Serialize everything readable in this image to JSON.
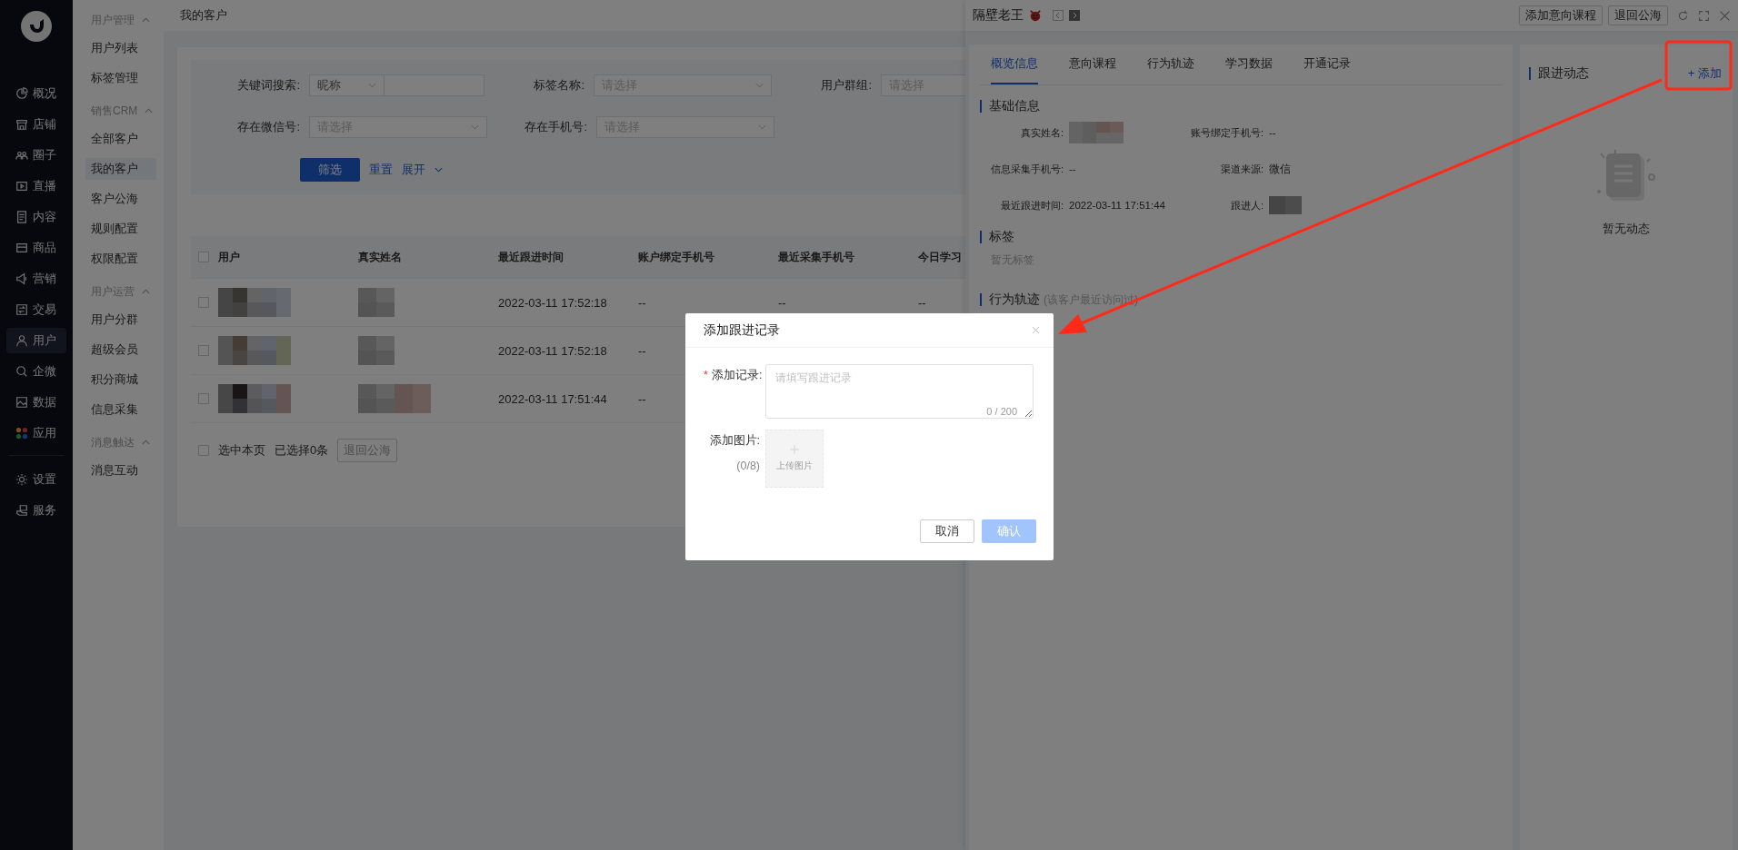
{
  "nav": {
    "primary": [
      {
        "label": "概况",
        "selected": false
      },
      {
        "label": "店铺",
        "selected": false
      },
      {
        "label": "圈子",
        "selected": false
      },
      {
        "label": "直播",
        "selected": false
      },
      {
        "label": "内容",
        "selected": false
      },
      {
        "label": "商品",
        "selected": false
      },
      {
        "label": "营销",
        "selected": false
      },
      {
        "label": "交易",
        "selected": false
      },
      {
        "label": "用户",
        "selected": true
      },
      {
        "label": "企微",
        "selected": false
      },
      {
        "label": "数据",
        "selected": false
      },
      {
        "label": "应用",
        "selected": false
      }
    ],
    "secondary": [
      {
        "label": "设置",
        "selected": false
      },
      {
        "label": "服务",
        "selected": false
      }
    ]
  },
  "submenu": [
    {
      "title": "用户管理",
      "expanded": true,
      "items": [
        {
          "label": "用户列表",
          "selected": false
        },
        {
          "label": "标签管理",
          "selected": false
        }
      ]
    },
    {
      "title": "销售CRM",
      "expanded": true,
      "items": [
        {
          "label": "全部客户",
          "selected": false
        },
        {
          "label": "我的客户",
          "selected": true
        },
        {
          "label": "客户公海",
          "selected": false
        },
        {
          "label": "规则配置",
          "selected": false
        },
        {
          "label": "权限配置",
          "selected": false
        }
      ]
    },
    {
      "title": "用户运营",
      "expanded": true,
      "items": [
        {
          "label": "用户分群",
          "selected": false
        },
        {
          "label": "超级会员",
          "selected": false
        },
        {
          "label": "积分商城",
          "selected": false
        },
        {
          "label": "信息采集",
          "selected": false
        }
      ]
    },
    {
      "title": "消息触达",
      "expanded": true,
      "items": [
        {
          "label": "消息互动",
          "selected": false
        }
      ]
    }
  ],
  "page_title": "我的客户",
  "filters": {
    "fields": [
      {
        "kind": "keyword",
        "label": "关键词搜索:",
        "select": "昵称"
      },
      {
        "kind": "select",
        "label": "标签名称:",
        "placeholder": "请选择"
      },
      {
        "kind": "select",
        "label": "用户群组:",
        "placeholder": "请选择"
      },
      {
        "kind": "select",
        "label": "存在微信号:",
        "placeholder": "请选择"
      },
      {
        "kind": "select",
        "label": "存在手机号:",
        "placeholder": "请选择"
      }
    ],
    "filter_button": "筛选",
    "reset_link": "重置",
    "expand_link": "展开"
  },
  "table": {
    "all_checked": false,
    "columns": [
      "用户",
      "真实姓名",
      "最近跟进时间",
      "账户绑定手机号",
      "最近采集手机号",
      "今日学习"
    ],
    "rows": [
      {
        "checked": false,
        "cells": [
          null,
          null,
          "2022-03-11 17:52:18",
          "--",
          "--",
          "--"
        ]
      },
      {
        "checked": false,
        "cells": [
          null,
          null,
          "2022-03-11 17:52:18",
          "--"
        ]
      },
      {
        "checked": false,
        "cells": [
          null,
          null,
          "2022-03-11 17:51:44",
          "--"
        ]
      }
    ]
  },
  "footer": {
    "select_page": {
      "label": "选中本页",
      "checked": false
    },
    "selected_count": "已选择0条",
    "return_button": "退回公海"
  },
  "drawer": {
    "title": "隔壁老王",
    "buttons": [
      "添加意向课程",
      "退回公海"
    ],
    "tabs": [
      {
        "label": "概览信息",
        "selected": true
      },
      {
        "label": "意向课程",
        "selected": false
      },
      {
        "label": "行为轨迹",
        "selected": false
      },
      {
        "label": "学习数据",
        "selected": false
      },
      {
        "label": "开通记录",
        "selected": false
      }
    ],
    "basic": {
      "title": "基础信息",
      "fields": [
        {
          "label": "真实姓名:",
          "kind": "blurred"
        },
        {
          "label": "账号绑定手机号:",
          "kind": "text",
          "value": "--"
        },
        {
          "label": "信息采集手机号:",
          "kind": "text",
          "value": "--"
        },
        {
          "label": "渠道来源:",
          "kind": "text",
          "value": "微信"
        },
        {
          "label": "最近跟进时间:",
          "kind": "text",
          "value": "2022-03-11 17:51:44"
        },
        {
          "label": "跟进人:",
          "kind": "blurred"
        }
      ]
    },
    "tags": {
      "title": "标签",
      "empty": "暂无标签"
    },
    "behavior": {
      "title": "行为轨迹",
      "note": "(该客户最近访问过)"
    },
    "follow": {
      "title": "跟进动态",
      "add": "+ 添加",
      "empty": "暂无动态"
    }
  },
  "modal": {
    "title": "添加跟进记录",
    "record_label": "添加记录:",
    "required_mark": "*",
    "placeholder": "请填写跟进记录",
    "counter": "0 / 200",
    "image_label": "添加图片:",
    "image_count": "(0/8)",
    "upload": "上传图片",
    "cancel": "取消",
    "confirm": "确认",
    "confirm_disabled": true
  }
}
